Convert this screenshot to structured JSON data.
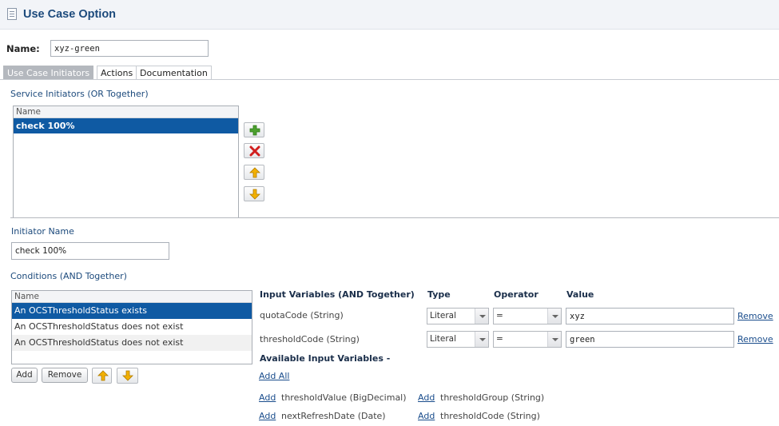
{
  "header": {
    "title": "Use Case Option"
  },
  "name_field": {
    "label": "Name:",
    "value": "xyz-green"
  },
  "tabs": [
    {
      "label": "Use Case Initiators",
      "active": true
    },
    {
      "label": "Actions",
      "active": false
    },
    {
      "label": "Documentation",
      "active": false
    }
  ],
  "service_initiators": {
    "title": "Service Initiators (OR Together)",
    "column_header": "Name",
    "rows": [
      {
        "name": "check 100%",
        "selected": true
      }
    ],
    "buttons": [
      "add-icon",
      "delete-icon",
      "arrow-up-icon",
      "arrow-down-icon"
    ]
  },
  "initiator_name": {
    "label": "Initiator Name",
    "value": "check 100%"
  },
  "conditions": {
    "title": "Conditions (AND Together)",
    "column_header": "Name",
    "rows": [
      {
        "name": "An OCSThresholdStatus exists",
        "selected": true
      },
      {
        "name": "An OCSThresholdStatus does not exist",
        "selected": false
      },
      {
        "name": "An OCSThresholdStatus does not exist",
        "selected": false
      }
    ],
    "add_label": "Add",
    "remove_label": "Remove"
  },
  "input_variables": {
    "headers": {
      "name": "Input Variables (AND Together)",
      "type": "Type",
      "operator": "Operator",
      "value": "Value"
    },
    "rows": [
      {
        "name": "quotaCode (String)",
        "type": "Literal",
        "operator": "=",
        "value": "xyz",
        "remove": "Remove"
      },
      {
        "name": "thresholdCode (String)",
        "type": "Literal",
        "operator": "=",
        "value": "green",
        "remove": "Remove"
      }
    ]
  },
  "available": {
    "title": "Available Input Variables -",
    "add_all": "Add All",
    "items": [
      {
        "add": "Add",
        "name": "thresholdValue (BigDecimal)"
      },
      {
        "add": "Add",
        "name": "thresholdGroup (String)"
      },
      {
        "add": "Add",
        "name": "nextRefreshDate (Date)"
      },
      {
        "add": "Add",
        "name": "thresholdCode (String)"
      }
    ]
  },
  "colors": {
    "title": "#1c4a7c",
    "selection": "#0f5aa3",
    "tab_active": "#b4b8be",
    "add_icon": "#4ca02e",
    "delete_icon": "#d11f1f",
    "arrow_icon": "#f2b000"
  }
}
